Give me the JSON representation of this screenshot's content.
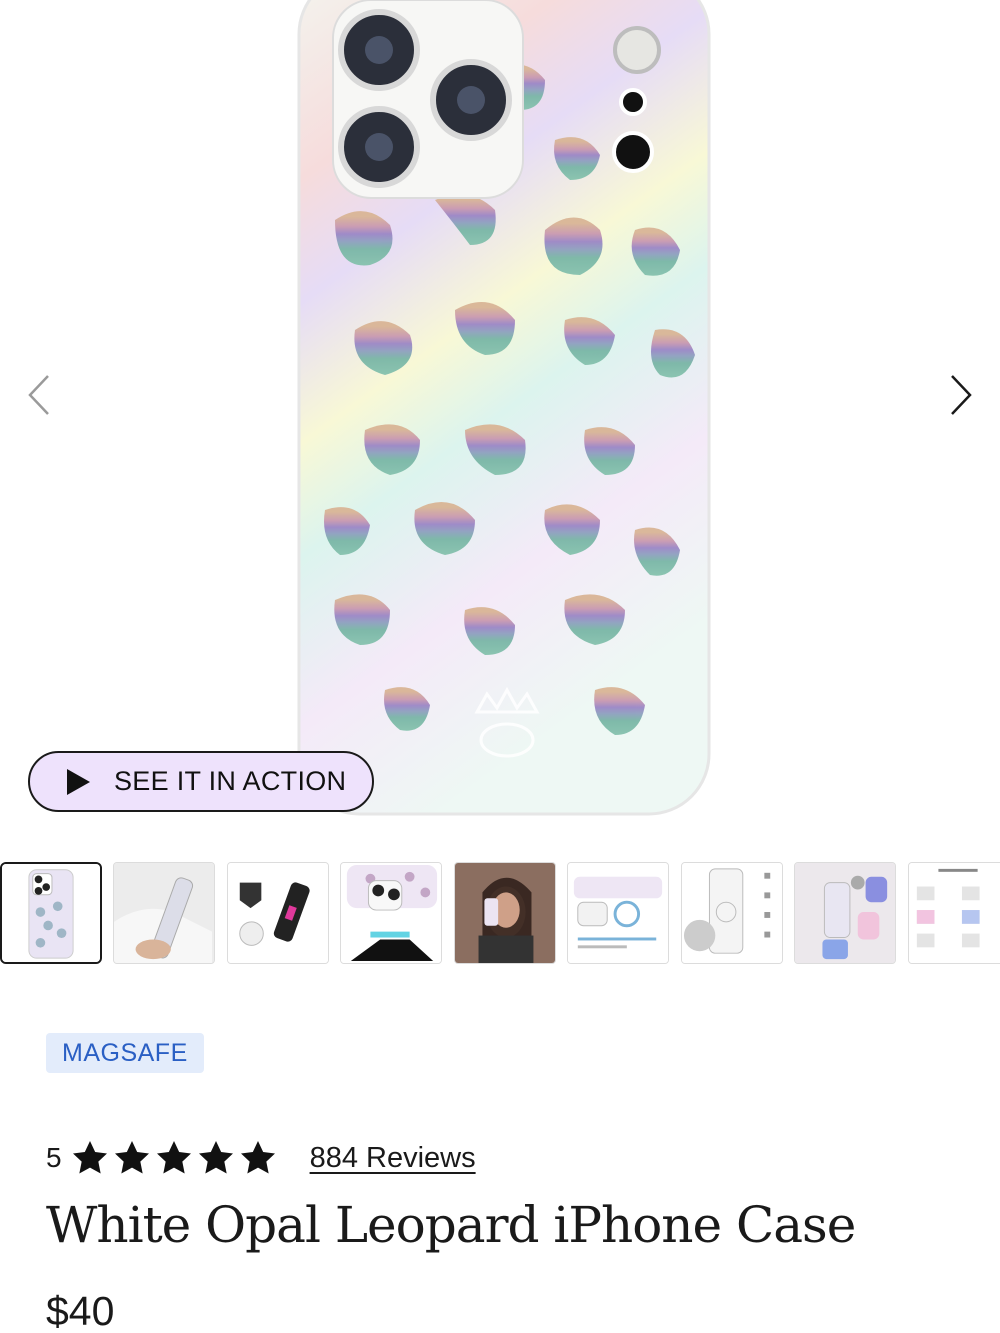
{
  "gallery": {
    "prev_icon": "chevron-left-icon",
    "next_icon": "chevron-right-icon",
    "video_button_label": "SEE IT IN ACTION",
    "video_icon": "play-icon",
    "active_thumbnail": 1,
    "thumbnails": [
      {
        "label": "Opal leopard case front"
      },
      {
        "label": "Case side view in hand"
      },
      {
        "label": "Drop test protection"
      },
      {
        "label": "Raised camera bezel"
      },
      {
        "label": "Model holding phone"
      },
      {
        "label": "MagSafe strength diagram"
      },
      {
        "label": "Case components"
      },
      {
        "label": "Matching accessories"
      },
      {
        "label": "Make it Match"
      }
    ]
  },
  "product": {
    "badge": "MAGSAFE",
    "rating": "5",
    "rating_stars": 5,
    "reviews_label": "884 Reviews",
    "title": "White Opal Leopard iPhone Case",
    "price": "$40"
  },
  "colors": {
    "badge_bg": "#e3ecfb",
    "badge_text": "#2a5fc4",
    "video_button_bg": "#eee2fc",
    "text": "#1a1a1a"
  }
}
